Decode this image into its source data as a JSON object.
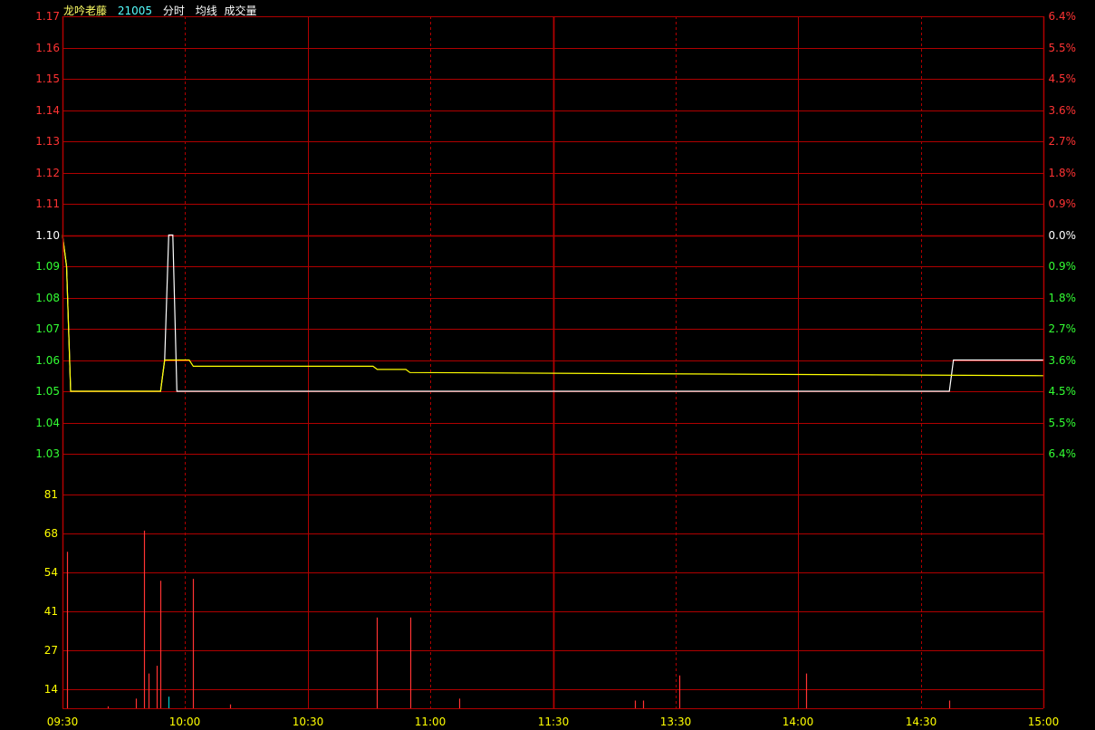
{
  "header": {
    "name": "龙吟老藤",
    "code": "21005",
    "indicators": [
      "分时",
      "均线",
      "成交量"
    ]
  },
  "colors": {
    "background": "#000000",
    "grid": "#b00000",
    "up": "#ff3333",
    "down": "#33ff33",
    "neutral": "#ffffff",
    "price_line": "#ffffff",
    "avg_line": "#ffff00",
    "volume": "#ff3333",
    "volume_down": "#00cccc",
    "volume_label": "#ffff00"
  },
  "chart_data": {
    "type": "line",
    "prev_close": 1.1,
    "price_ticks": [
      "1.17",
      "1.16",
      "1.15",
      "1.14",
      "1.13",
      "1.12",
      "1.11",
      "1.10",
      "1.09",
      "1.08",
      "1.07",
      "1.06",
      "1.05",
      "1.04",
      "1.03"
    ],
    "pct_ticks": [
      "6.4%",
      "5.5%",
      "4.5%",
      "3.6%",
      "2.7%",
      "1.8%",
      "0.9%",
      "0.0%",
      "0.9%",
      "1.8%",
      "2.7%",
      "3.6%",
      "4.5%",
      "5.5%",
      "6.4%"
    ],
    "volume_ticks": [
      "81",
      "68",
      "54",
      "41",
      "27",
      "14"
    ],
    "x_ticks": [
      "09:30",
      "10:00",
      "10:30",
      "11:00",
      "11:30",
      "13:30",
      "14:00",
      "14:30",
      "15:00"
    ],
    "ylim": [
      1.03,
      1.17
    ],
    "volume_max": 121,
    "series": [
      {
        "points": [
          [
            0,
            1.1
          ],
          [
            1,
            1.09
          ],
          [
            2,
            1.05
          ],
          [
            24,
            1.05
          ],
          [
            25,
            1.06
          ],
          [
            26,
            1.1
          ],
          [
            27,
            1.1
          ],
          [
            28,
            1.05
          ],
          [
            217,
            1.05
          ],
          [
            218,
            1.06
          ],
          [
            240,
            1.06
          ]
        ]
      },
      {
        "points": [
          [
            0,
            1.1
          ],
          [
            1,
            1.09
          ],
          [
            2,
            1.05
          ],
          [
            24,
            1.05
          ],
          [
            25,
            1.06
          ],
          [
            31,
            1.06
          ],
          [
            32,
            1.058
          ],
          [
            76,
            1.058
          ],
          [
            77,
            1.057
          ],
          [
            84,
            1.057
          ],
          [
            85,
            1.056
          ],
          [
            240,
            1.055
          ]
        ]
      }
    ],
    "volume": [
      [
        1,
        81,
        "up"
      ],
      [
        11,
        1,
        "up"
      ],
      [
        18,
        5,
        "up"
      ],
      [
        20,
        92,
        "up"
      ],
      [
        21,
        18,
        "up"
      ],
      [
        23,
        22,
        "up"
      ],
      [
        24,
        66,
        "up"
      ],
      [
        26,
        6,
        "down"
      ],
      [
        32,
        67,
        "up"
      ],
      [
        41,
        2,
        "up"
      ],
      [
        77,
        47,
        "up"
      ],
      [
        85,
        47,
        "up"
      ],
      [
        97,
        5,
        "up"
      ],
      [
        140,
        4,
        "up"
      ],
      [
        142,
        4,
        "up"
      ],
      [
        151,
        17,
        "up"
      ],
      [
        182,
        18,
        "up"
      ],
      [
        217,
        4,
        "up"
      ]
    ]
  }
}
